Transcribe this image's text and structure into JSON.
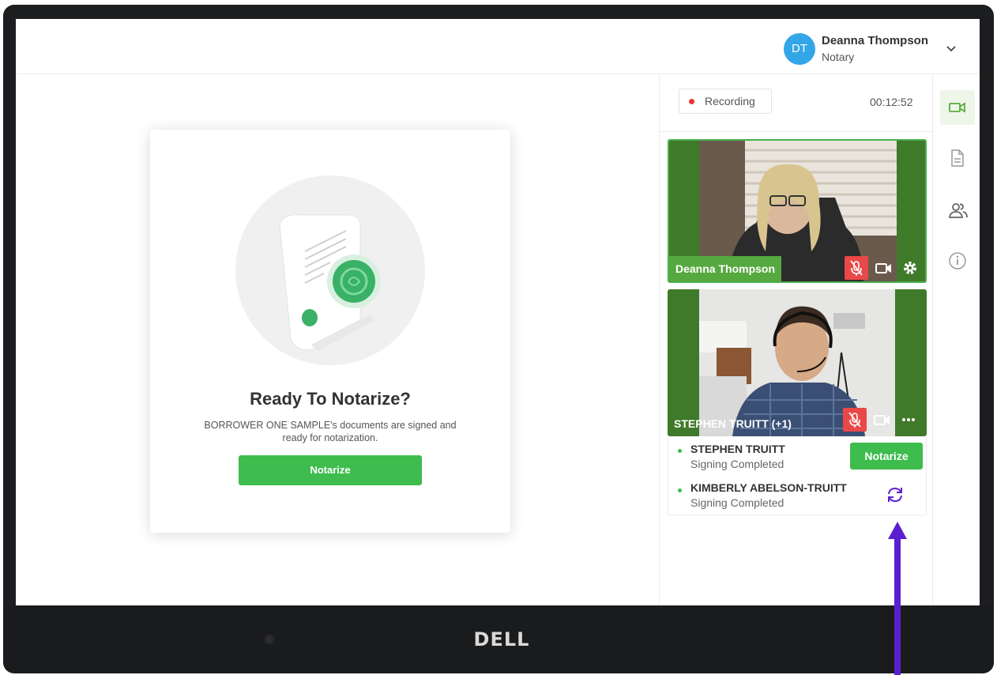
{
  "header": {
    "avatar_initials": "DT",
    "user_name": "Deanna Thompson",
    "user_role": "Notary",
    "avatar_color": "#33a6e8"
  },
  "main": {
    "title": "Ready To Notarize?",
    "description": "BORROWER ONE SAMPLE's documents are signed and ready for notarization.",
    "button_label": "Notarize"
  },
  "panel": {
    "recording_label": "Recording",
    "timer": "00:12:52",
    "videos": [
      {
        "name": "Deanna Thompson"
      },
      {
        "name": "STEPHEN TRUITT (+1)"
      }
    ],
    "participants": [
      {
        "name": "STEPHEN TRUITT",
        "status": "Signing Completed",
        "action_label": "Notarize"
      },
      {
        "name": "KIMBERLY ABELSON-TRUITT",
        "status": "Signing Completed"
      }
    ]
  },
  "toolbar": {
    "items": [
      "video-icon",
      "document-icon",
      "participants-icon",
      "info-icon"
    ]
  },
  "device": {
    "brand": "DELL"
  },
  "colors": {
    "accent_green": "#3ebc4e",
    "recording_red": "#e53935",
    "annotation_purple": "#5b1fd1"
  }
}
